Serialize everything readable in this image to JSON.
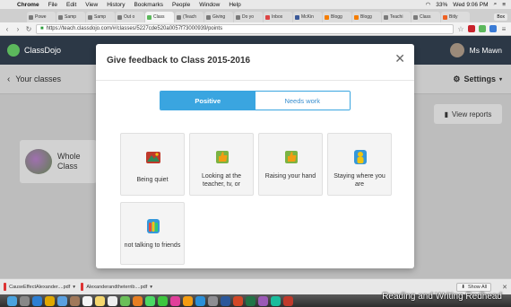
{
  "menubar": {
    "app": "Chrome",
    "items": [
      "File",
      "Edit",
      "View",
      "History",
      "Bookmarks",
      "People",
      "Window",
      "Help"
    ],
    "battery": "33%",
    "clock": "Wed 9:06 PM"
  },
  "tabs": [
    {
      "label": "Powe"
    },
    {
      "label": "Samp"
    },
    {
      "label": "Samp"
    },
    {
      "label": "Out o"
    },
    {
      "label": "Class"
    },
    {
      "label": "(Teach"
    },
    {
      "label": "Giving"
    },
    {
      "label": "Do yo"
    },
    {
      "label": "Inbox"
    },
    {
      "label": "McKin"
    },
    {
      "label": "Blogg"
    },
    {
      "label": "Blogg"
    },
    {
      "label": "Teachi"
    },
    {
      "label": "Class"
    },
    {
      "label": "Bitly"
    }
  ],
  "browser_user": "Box",
  "address": {
    "url": "https://teach.classdojo.com/#/classes/5227cde520a0057f73000939/points"
  },
  "classdojo": {
    "brand": "ClassDojo",
    "user_name": "Ms Mawn",
    "back_label": "Your classes",
    "settings_label": "Settings",
    "view_reports_label": "View reports",
    "whole_class_label": "Whole Class"
  },
  "modal": {
    "title": "Give feedback to Class 2015-2016",
    "tab_positive": "Positive",
    "tab_needs_work": "Needs work",
    "skills": [
      {
        "label": "Being quiet",
        "icon": "mountain-icon"
      },
      {
        "label": "Looking at the teacher, tv, or",
        "icon": "thumbs-up-icon"
      },
      {
        "label": "Raising your hand",
        "icon": "thumbs-up-icon"
      },
      {
        "label": "Staying where you are",
        "icon": "person-icon"
      },
      {
        "label": "not talking to friends",
        "icon": "crowd-icon"
      }
    ]
  },
  "downloads": {
    "files": [
      {
        "name": "CauseEffectAlexander....pdf"
      },
      {
        "name": "Alexanderandtheterrib....pdf"
      }
    ],
    "show_all": "Show All"
  },
  "watermark": "Reading and Writing Redhead",
  "colors": {
    "accent": "#3aa5e0",
    "header_bg": "#2c3846"
  }
}
